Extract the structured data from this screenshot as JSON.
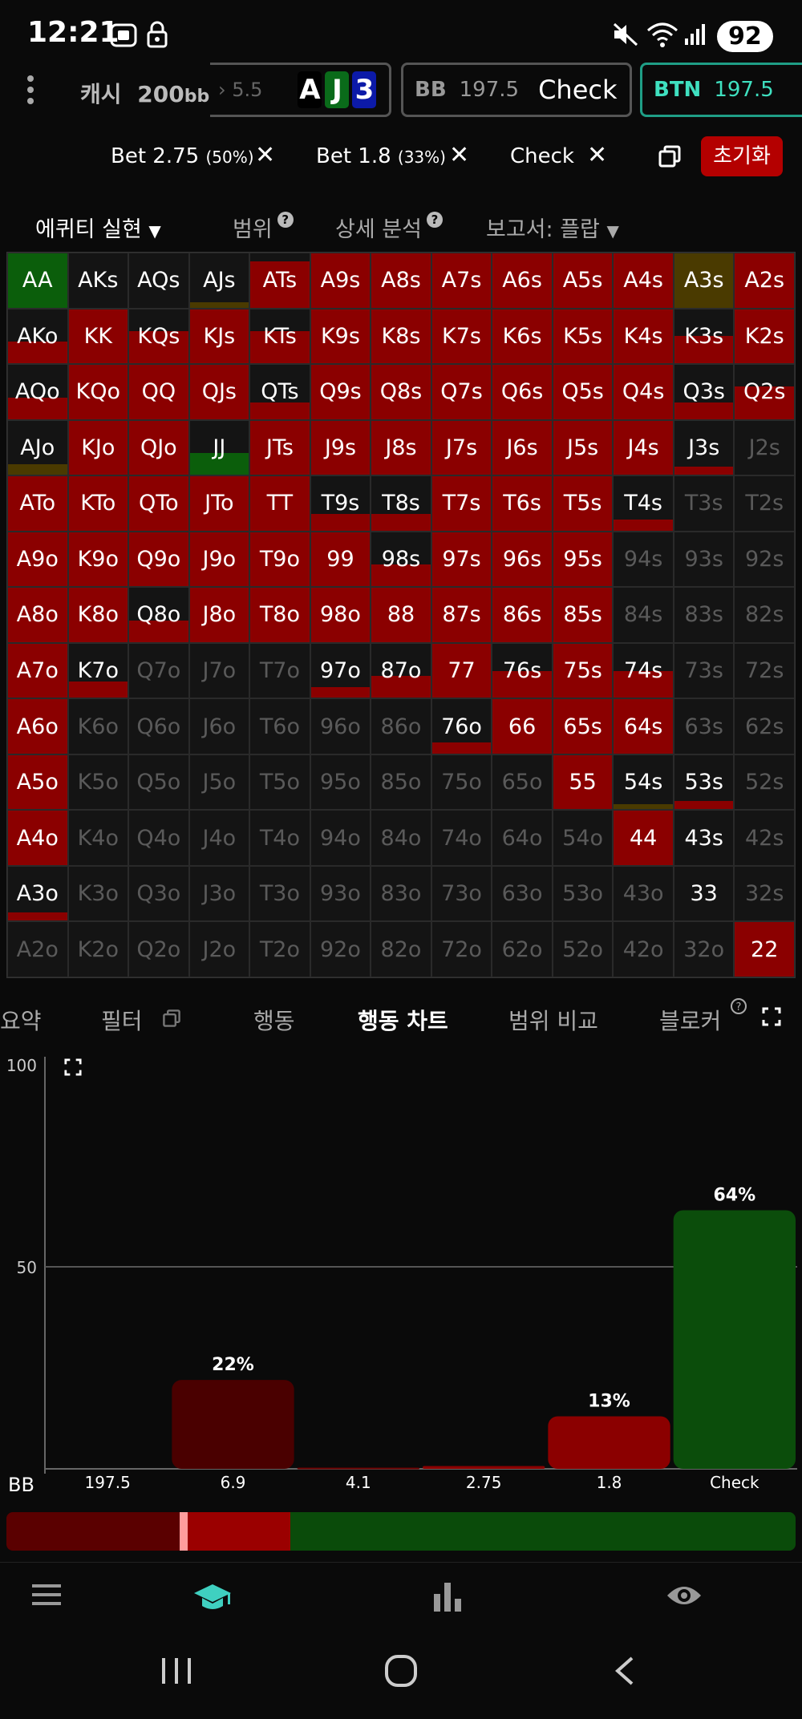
{
  "status": {
    "time": "12:21",
    "battery": "92"
  },
  "header": {
    "menu_icon": "vertical-dots-icon",
    "game_type": "캐시",
    "stack": "200",
    "stack_unit": "bb",
    "prev_bet": "5.5",
    "board": [
      {
        "rank": "A",
        "color": "#000000"
      },
      {
        "rank": "J",
        "color": "#0a6b1a"
      },
      {
        "rank": "3",
        "color": "#0c1aa8"
      }
    ],
    "bb_position": "BB",
    "bb_stack": "197.5",
    "bb_action": "Check",
    "btn_position": "BTN",
    "btn_stack": "197.5"
  },
  "actions": {
    "items": [
      {
        "label": "Bet 2.75",
        "pct": "(50%)"
      },
      {
        "label": "Bet 1.8",
        "pct": "(33%)"
      },
      {
        "label": "Check",
        "pct": ""
      }
    ],
    "reset_label": "초기화"
  },
  "tabs": {
    "equity": "에퀴티 실현",
    "range": "범위",
    "detail": "상세 분석",
    "report": "보고서: 플랍"
  },
  "grid": {
    "cells": [
      [
        "AA",
        1,
        "g"
      ],
      [
        "AKs",
        0,
        ""
      ],
      [
        "AQs",
        0,
        ""
      ],
      [
        "AJs",
        0.1,
        "o"
      ],
      [
        "ATs",
        0.85,
        "r"
      ],
      [
        "A9s",
        1,
        "r"
      ],
      [
        "A8s",
        1,
        "r"
      ],
      [
        "A7s",
        1,
        "r"
      ],
      [
        "A6s",
        1,
        "r"
      ],
      [
        "A5s",
        1,
        "r"
      ],
      [
        "A4s",
        1,
        "r"
      ],
      [
        "A3s",
        1,
        "o"
      ],
      [
        "A2s",
        1,
        "r"
      ],
      [
        "AKo",
        0.4,
        "r"
      ],
      [
        "KK",
        1,
        "r"
      ],
      [
        "KQs",
        0.6,
        "r"
      ],
      [
        "KJs",
        1,
        "r"
      ],
      [
        "KTs",
        0.6,
        "r"
      ],
      [
        "K9s",
        1,
        "r"
      ],
      [
        "K8s",
        1,
        "r"
      ],
      [
        "K7s",
        1,
        "r"
      ],
      [
        "K6s",
        1,
        "r"
      ],
      [
        "K5s",
        1,
        "r"
      ],
      [
        "K4s",
        1,
        "r"
      ],
      [
        "K3s",
        0.5,
        "r"
      ],
      [
        "K2s",
        1,
        "r"
      ],
      [
        "AQo",
        0.4,
        "r"
      ],
      [
        "KQo",
        1,
        "r"
      ],
      [
        "QQ",
        1,
        "r"
      ],
      [
        "QJs",
        1,
        "r"
      ],
      [
        "QTs",
        0.3,
        "r"
      ],
      [
        "Q9s",
        1,
        "r"
      ],
      [
        "Q8s",
        1,
        "r"
      ],
      [
        "Q7s",
        1,
        "r"
      ],
      [
        "Q6s",
        1,
        "r"
      ],
      [
        "Q5s",
        1,
        "r"
      ],
      [
        "Q4s",
        1,
        "r"
      ],
      [
        "Q3s",
        0.3,
        "r"
      ],
      [
        "Q2s",
        0.6,
        "r"
      ],
      [
        "AJo",
        0.2,
        "o"
      ],
      [
        "KJo",
        1,
        "r"
      ],
      [
        "QJo",
        1,
        "r"
      ],
      [
        "JJ",
        0.4,
        "g"
      ],
      [
        "JTs",
        1,
        "r"
      ],
      [
        "J9s",
        1,
        "r"
      ],
      [
        "J8s",
        1,
        "r"
      ],
      [
        "J7s",
        1,
        "r"
      ],
      [
        "J6s",
        1,
        "r"
      ],
      [
        "J5s",
        1,
        "r"
      ],
      [
        "J4s",
        1,
        "r"
      ],
      [
        "J3s",
        0.15,
        "r"
      ],
      [
        "J2s",
        0,
        "dim"
      ],
      [
        "ATo",
        1,
        "r"
      ],
      [
        "KTo",
        1,
        "r"
      ],
      [
        "QTo",
        1,
        "r"
      ],
      [
        "JTo",
        1,
        "r"
      ],
      [
        "TT",
        1,
        "r"
      ],
      [
        "T9s",
        0.3,
        "r"
      ],
      [
        "T8s",
        0.3,
        "r"
      ],
      [
        "T7s",
        1,
        "r"
      ],
      [
        "T6s",
        1,
        "r"
      ],
      [
        "T5s",
        1,
        "r"
      ],
      [
        "T4s",
        0.2,
        "r"
      ],
      [
        "T3s",
        0,
        "dim"
      ],
      [
        "T2s",
        0,
        "dim"
      ],
      [
        "A9o",
        1,
        "r"
      ],
      [
        "K9o",
        1,
        "r"
      ],
      [
        "Q9o",
        1,
        "r"
      ],
      [
        "J9o",
        1,
        "r"
      ],
      [
        "T9o",
        1,
        "r"
      ],
      [
        "99",
        1,
        "r"
      ],
      [
        "98s",
        0.4,
        "r"
      ],
      [
        "97s",
        1,
        "r"
      ],
      [
        "96s",
        1,
        "r"
      ],
      [
        "95s",
        1,
        "r"
      ],
      [
        "94s",
        0,
        "dim"
      ],
      [
        "93s",
        0,
        "dim"
      ],
      [
        "92s",
        0,
        "dim"
      ],
      [
        "A8o",
        1,
        "r"
      ],
      [
        "K8o",
        1,
        "r"
      ],
      [
        "Q8o",
        0.4,
        "r"
      ],
      [
        "J8o",
        1,
        "r"
      ],
      [
        "T8o",
        1,
        "r"
      ],
      [
        "98o",
        1,
        "r"
      ],
      [
        "88",
        1,
        "r"
      ],
      [
        "87s",
        1,
        "r"
      ],
      [
        "86s",
        1,
        "r"
      ],
      [
        "85s",
        1,
        "r"
      ],
      [
        "84s",
        0,
        "dim"
      ],
      [
        "83s",
        0,
        "dim"
      ],
      [
        "82s",
        0,
        "dim"
      ],
      [
        "A7o",
        1,
        "r"
      ],
      [
        "K7o",
        0.3,
        "r"
      ],
      [
        "Q7o",
        0,
        "dim"
      ],
      [
        "J7o",
        0,
        "dim"
      ],
      [
        "T7o",
        0,
        "dim"
      ],
      [
        "97o",
        0.2,
        "r"
      ],
      [
        "87o",
        0.4,
        "r"
      ],
      [
        "77",
        1,
        "r"
      ],
      [
        "76s",
        0.5,
        "r"
      ],
      [
        "75s",
        1,
        "r"
      ],
      [
        "74s",
        0.5,
        "r"
      ],
      [
        "73s",
        0,
        "dim"
      ],
      [
        "72s",
        0,
        "dim"
      ],
      [
        "A6o",
        1,
        "r"
      ],
      [
        "K6o",
        0,
        "dim"
      ],
      [
        "Q6o",
        0,
        "dim"
      ],
      [
        "J6o",
        0,
        "dim"
      ],
      [
        "T6o",
        0,
        "dim"
      ],
      [
        "96o",
        0,
        "dim"
      ],
      [
        "86o",
        0,
        "dim"
      ],
      [
        "76o",
        0.2,
        "r"
      ],
      [
        "66",
        1,
        "r"
      ],
      [
        "65s",
        1,
        "r"
      ],
      [
        "64s",
        1,
        "r"
      ],
      [
        "63s",
        0,
        "dim"
      ],
      [
        "62s",
        0,
        "dim"
      ],
      [
        "A5o",
        1,
        "r"
      ],
      [
        "K5o",
        0,
        "dim"
      ],
      [
        "Q5o",
        0,
        "dim"
      ],
      [
        "J5o",
        0,
        "dim"
      ],
      [
        "T5o",
        0,
        "dim"
      ],
      [
        "95o",
        0,
        "dim"
      ],
      [
        "85o",
        0,
        "dim"
      ],
      [
        "75o",
        0,
        "dim"
      ],
      [
        "65o",
        0,
        "dim"
      ],
      [
        "55",
        1,
        "r"
      ],
      [
        "54s",
        0.1,
        "o"
      ],
      [
        "53s",
        0.15,
        "r"
      ],
      [
        "52s",
        0,
        "dim"
      ],
      [
        "A4o",
        1,
        "r"
      ],
      [
        "K4o",
        0,
        "dim"
      ],
      [
        "Q4o",
        0,
        "dim"
      ],
      [
        "J4o",
        0,
        "dim"
      ],
      [
        "T4o",
        0,
        "dim"
      ],
      [
        "94o",
        0,
        "dim"
      ],
      [
        "84o",
        0,
        "dim"
      ],
      [
        "74o",
        0,
        "dim"
      ],
      [
        "64o",
        0,
        "dim"
      ],
      [
        "54o",
        0,
        "dim"
      ],
      [
        "44",
        1,
        "r"
      ],
      [
        "43s",
        0,
        ""
      ],
      [
        "42s",
        0,
        "dim"
      ],
      [
        "A3o",
        0.15,
        "r"
      ],
      [
        "K3o",
        0,
        "dim"
      ],
      [
        "Q3o",
        0,
        "dim"
      ],
      [
        "J3o",
        0,
        "dim"
      ],
      [
        "T3o",
        0,
        "dim"
      ],
      [
        "93o",
        0,
        "dim"
      ],
      [
        "83o",
        0,
        "dim"
      ],
      [
        "73o",
        0,
        "dim"
      ],
      [
        "63o",
        0,
        "dim"
      ],
      [
        "53o",
        0,
        "dim"
      ],
      [
        "43o",
        0,
        "dim"
      ],
      [
        "33",
        0,
        ""
      ],
      [
        "32s",
        0,
        "dim"
      ],
      [
        "A2o",
        0,
        "dim"
      ],
      [
        "K2o",
        0,
        "dim"
      ],
      [
        "Q2o",
        0,
        "dim"
      ],
      [
        "J2o",
        0,
        "dim"
      ],
      [
        "T2o",
        0,
        "dim"
      ],
      [
        "92o",
        0,
        "dim"
      ],
      [
        "82o",
        0,
        "dim"
      ],
      [
        "72o",
        0,
        "dim"
      ],
      [
        "62o",
        0,
        "dim"
      ],
      [
        "52o",
        0,
        "dim"
      ],
      [
        "42o",
        0,
        "dim"
      ],
      [
        "32o",
        0,
        "dim"
      ],
      [
        "22",
        1,
        "r"
      ]
    ],
    "colors": {
      "r": "#8b0000",
      "g": "#0b5e0b",
      "o": "#4a3a00"
    }
  },
  "bottom_tabs": {
    "summary": "요약",
    "filter": "필터",
    "action": "행동",
    "action_chart": "행동 차트",
    "range_compare": "범위 비교",
    "blocker": "블로커"
  },
  "chart_data": {
    "type": "bar",
    "categories": [
      "197.5",
      "6.9",
      "4.1",
      "2.75",
      "1.8",
      "Check"
    ],
    "values": [
      0,
      22,
      0.3,
      0.7,
      13,
      64
    ],
    "data_labels": [
      "",
      "22%",
      "",
      "",
      "13%",
      "64%"
    ],
    "colors": [
      "#4a0000",
      "#4a0000",
      "#6a0000",
      "#8b0000",
      "#8b0000",
      "#0b4d0b"
    ],
    "ylim": [
      0,
      100
    ],
    "yticks": [
      "100",
      "50"
    ],
    "xlabel_prefix": "BB"
  },
  "freq_bar": {
    "segments": [
      {
        "value": 22,
        "color": "#5a0000"
      },
      {
        "value": 1,
        "color": "#ff9c9c"
      },
      {
        "value": 13,
        "color": "#9b0000"
      },
      {
        "value": 64,
        "color": "#0a4b0a"
      }
    ]
  },
  "nav": {
    "icons": [
      "menu-icon",
      "study-icon",
      "stats-icon",
      "view-icon"
    ]
  },
  "system_nav": {
    "icons": [
      "recents-icon",
      "home-icon",
      "back-icon"
    ]
  }
}
